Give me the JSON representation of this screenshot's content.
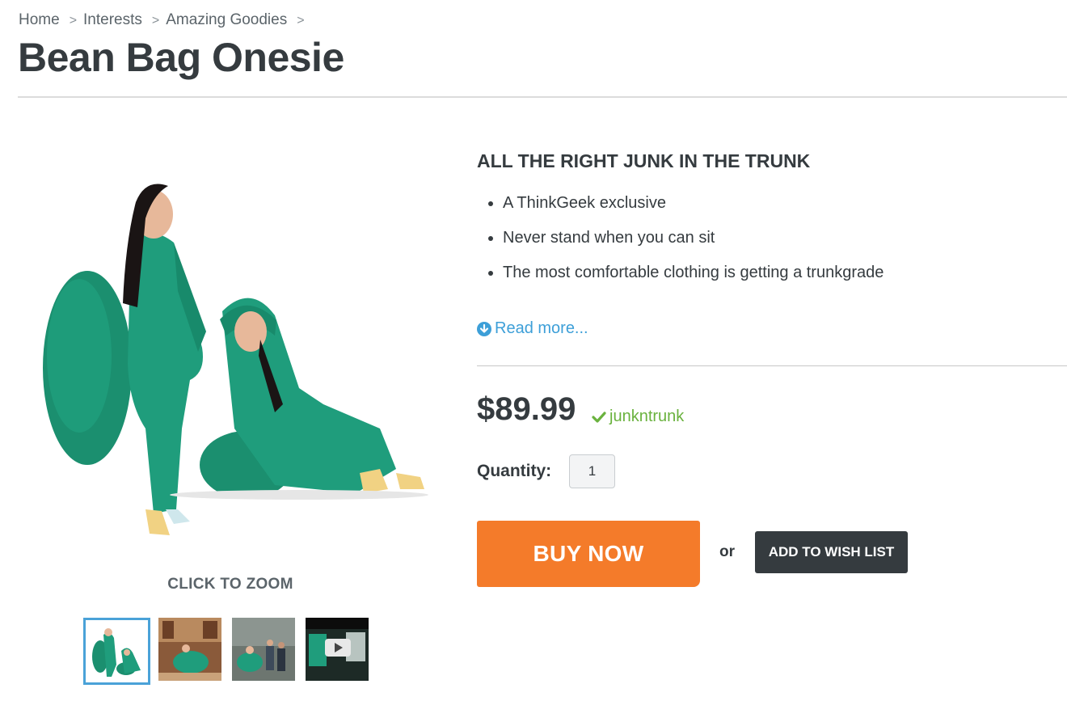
{
  "breadcrumb": {
    "items": [
      "Home",
      "Interests",
      "Amazing Goodies"
    ],
    "separator": ">"
  },
  "product": {
    "title": "Bean Bag Onesie",
    "tagline": "ALL THE RIGHT JUNK IN THE TRUNK",
    "features": [
      "A ThinkGeek exclusive",
      "Never stand when you can sit",
      "The most comfortable clothing is getting a trunkgrade"
    ],
    "read_more": "Read more...",
    "price": "$89.99",
    "promo_code": "junkntrunk",
    "quantity_label": "Quantity:",
    "quantity_value": "1"
  },
  "gallery": {
    "zoom_label": "CLICK TO ZOOM",
    "thumbnail_count": 4,
    "active_thumbnail": 1
  },
  "actions": {
    "buy_now": "BUY NOW",
    "or": "or",
    "add_to_wishlist": "ADD TO WISH LIST"
  },
  "colors": {
    "onesie_green": "#1f9d7c",
    "buy_orange": "#f47b2a",
    "wishlist_dark": "#353b3f",
    "link_blue": "#3d9fd8",
    "promo_green": "#6ab23e",
    "active_thumb_border": "#4aa2d8"
  },
  "icons": {
    "read_more": "circle-arrow-down-icon",
    "promo": "checkmark-icon",
    "video": "play-icon"
  }
}
